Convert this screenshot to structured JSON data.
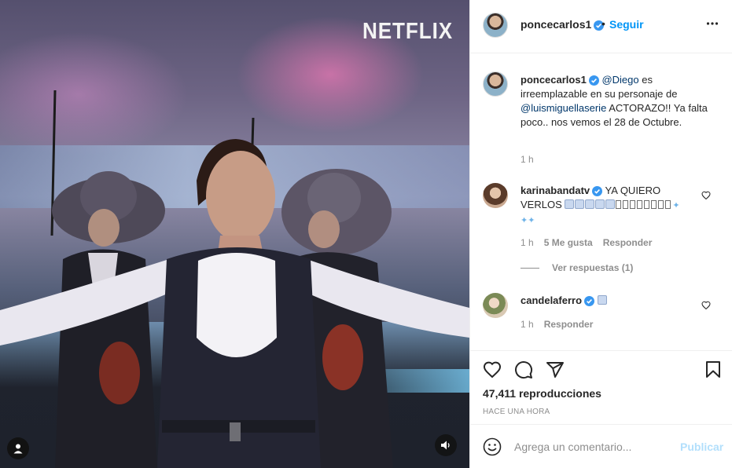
{
  "media": {
    "watermark": "NETFLIX",
    "user_button_icon": "user-tag-icon",
    "sound_button_icon": "speaker-icon"
  },
  "header": {
    "username": "poncecarlos1",
    "verified": true,
    "separator": "•",
    "follow_label": "Seguir",
    "more_icon": "more-options-icon"
  },
  "caption": {
    "username": "poncecarlos1",
    "mention1": "@Diego",
    "text1": " es irreemplazable en su personaje de ",
    "mention2": "@luismiguellaserie",
    "text2": " ACTORAZO!! Ya falta poco.. nos vemos el 28 de Octubre.",
    "time": "1 h"
  },
  "comments": [
    {
      "username": "karinabandatv",
      "text_prefix": "YA QUIERO VERLOS",
      "time": "1 h",
      "likes": "5 Me gusta",
      "reply": "Responder",
      "view_replies": "Ver respuestas (1)"
    },
    {
      "username": "candelaferro",
      "time": "1 h",
      "reply": "Responder"
    }
  ],
  "actions": {
    "icons": [
      "heart-icon",
      "comment-icon",
      "share-icon",
      "bookmark-icon"
    ],
    "views": "47,411 reproducciones",
    "posted": "HACE UNA HORA"
  },
  "comment_box": {
    "placeholder": "Agrega un comentario...",
    "publish_label": "Publicar"
  },
  "colors": {
    "link": "#0095f6",
    "mention": "#00376b",
    "verified": "#3897f0",
    "muted": "#8e8e8e",
    "publish_disabled": "#b2dffc"
  }
}
